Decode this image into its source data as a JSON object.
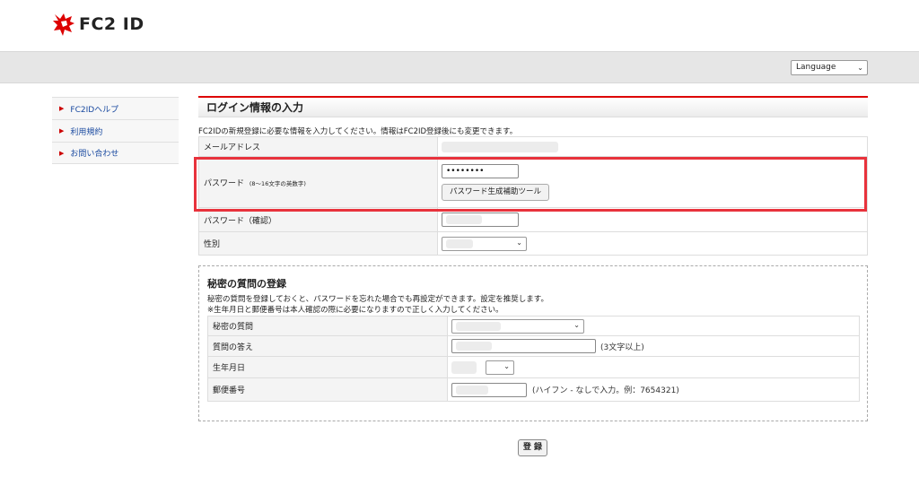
{
  "header": {
    "logo_text": "FC2 ID"
  },
  "language": {
    "label": "Language"
  },
  "sidebar": {
    "items": [
      {
        "label": "FC2IDヘルプ"
      },
      {
        "label": "利用規約"
      },
      {
        "label": "お問い合わせ"
      }
    ]
  },
  "login": {
    "title": "ログイン情報の入力",
    "description": "FC2IDの新規登録に必要な情報を入力してください。情報はFC2ID登録後にも変更できます。",
    "email_label": "メールアドレス",
    "password_label": "パスワード",
    "password_hint": "(8〜16文字の英数字)",
    "password_value": "••••••••",
    "password_tool_button": "パスワード生成補助ツール",
    "password_confirm_label": "パスワード（確認）",
    "gender_label": "性別"
  },
  "secret": {
    "title": "秘密の質問の登録",
    "description": "秘密の質問を登録しておくと、パスワードを忘れた場合でも再設定ができます。設定を推奨します。",
    "note": "※生年月日と郵便番号は本人確認の際に必要になりますので正しく入力してください。",
    "question_label": "秘密の質問",
    "answer_label": "質問の答え",
    "answer_hint": "(3文字以上)",
    "birthday_label": "生年月日",
    "postal_label": "郵便番号",
    "postal_hint": "(ハイフン - なしで入力。例：7654321)"
  },
  "submit": {
    "label": "登 録"
  },
  "colors": {
    "accent": "#d00000",
    "highlight": "#e8323c",
    "link": "#1a4aa0"
  }
}
